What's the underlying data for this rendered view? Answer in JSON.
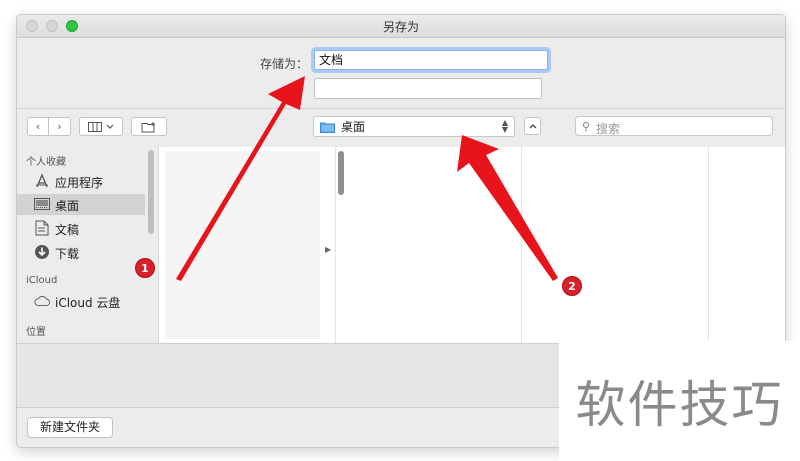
{
  "window": {
    "title": "另存为"
  },
  "save": {
    "label": "存储为：",
    "value": "文档",
    "tags_value": ""
  },
  "toolbar": {
    "back_icon": "chevron-left-icon",
    "forward_icon": "chevron-right-icon",
    "view_icon": "column-view-icon",
    "view_menu_icon": "chevron-down-icon",
    "new_folder_icon": "new-folder-icon",
    "location": "桌面",
    "location_icon": "folder-icon",
    "search_placeholder": "搜索"
  },
  "sidebar": {
    "favorites_header": "个人收藏",
    "items": [
      {
        "label": "应用程序",
        "icon": "applications-icon",
        "selected": false
      },
      {
        "label": "桌面",
        "icon": "desktop-icon",
        "selected": true
      },
      {
        "label": "文稿",
        "icon": "documents-icon",
        "selected": false
      },
      {
        "label": "下载",
        "icon": "downloads-icon",
        "selected": false
      }
    ],
    "icloud_header": "iCloud",
    "icloud_item": {
      "label": "iCloud 云盘",
      "icon": "cloud-icon"
    },
    "locations_header": "位置"
  },
  "footer": {
    "new_folder_label": "新建文件夹"
  },
  "annotations": {
    "badge1": "1",
    "badge2": "2",
    "arrow_color": "#e8141b"
  },
  "watermark": "软件技巧"
}
